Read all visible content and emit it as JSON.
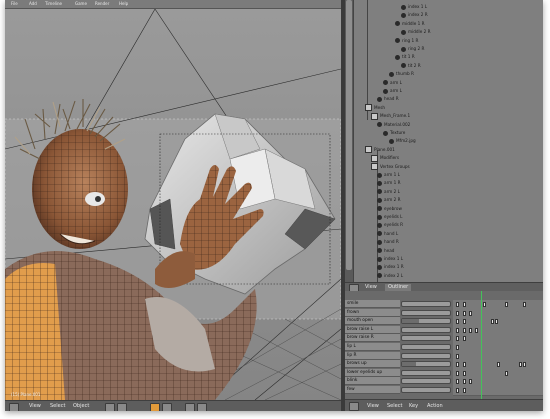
{
  "menubar": {
    "items": [
      "File",
      "Add",
      "Timeline",
      "Game",
      "Render",
      "Help"
    ]
  },
  "viewport": {
    "object_label": "(15) Plane.001",
    "footer": {
      "view": "View",
      "select": "Select",
      "object": "Object",
      "mode_icon": "mode-icon"
    }
  },
  "outliner": {
    "rows": [
      {
        "label": "index 1 L",
        "level": 7
      },
      {
        "label": "index 2 R",
        "level": 7
      },
      {
        "label": "middle 1 R",
        "level": 6
      },
      {
        "label": "middle 2 R",
        "level": 7
      },
      {
        "label": "ring 1 R",
        "level": 6
      },
      {
        "label": "ring 2 R",
        "level": 7
      },
      {
        "label": "tit 1 R",
        "level": 6
      },
      {
        "label": "tit 2 R",
        "level": 7
      },
      {
        "label": "thumb R",
        "level": 5
      },
      {
        "label": "arm L",
        "level": 4
      },
      {
        "label": "arm L",
        "level": 4
      },
      {
        "label": "head R",
        "level": 3
      },
      {
        "label": "Mesh",
        "level": 1
      },
      {
        "label": "Mesh_Frame.1",
        "level": 2
      },
      {
        "label": "Material.002",
        "level": 3
      },
      {
        "label": "Texture",
        "level": 4
      },
      {
        "label": "Mfm2.jpg",
        "level": 5
      },
      {
        "label": "Plane.001",
        "level": 1
      },
      {
        "label": "Modifiers",
        "level": 2
      },
      {
        "label": "Vertex Groups",
        "level": 2
      },
      {
        "label": "arm 1 L",
        "level": 3
      },
      {
        "label": "arm 1 R",
        "level": 3
      },
      {
        "label": "arm 2 L",
        "level": 3
      },
      {
        "label": "arm 2 R",
        "level": 3
      },
      {
        "label": "eyebrow",
        "level": 3
      },
      {
        "label": "eyelids L",
        "level": 3
      },
      {
        "label": "eyelids R",
        "level": 3
      },
      {
        "label": "hand L",
        "level": 3
      },
      {
        "label": "hand R",
        "level": 3
      },
      {
        "label": "head",
        "level": 3
      },
      {
        "label": "index 1 L",
        "level": 3
      },
      {
        "label": "index 1 R",
        "level": 3
      },
      {
        "label": "index 2 L",
        "level": 3
      }
    ],
    "footer": {
      "view": "View",
      "mode": "Outliner"
    }
  },
  "action": {
    "rows": [
      {
        "name": "smile",
        "value": 0.0,
        "keys": [
          3,
          10,
          30,
          52,
          70
        ]
      },
      {
        "name": "frown",
        "value": 0.0,
        "keys": [
          3,
          10,
          16
        ]
      },
      {
        "name": "mouth open",
        "value": 0.35,
        "keys": [
          3,
          10,
          38,
          42
        ]
      },
      {
        "name": "brow raise L",
        "value": 0.0,
        "keys": [
          3,
          10,
          16,
          22
        ]
      },
      {
        "name": "brow raise R",
        "value": 0.0,
        "keys": [
          3,
          10
        ]
      },
      {
        "name": "lip L",
        "value": 0.0,
        "keys": [
          3
        ]
      },
      {
        "name": "lip R",
        "value": 0.0,
        "keys": [
          3
        ]
      },
      {
        "name": "brows up",
        "value": 0.3,
        "keys": [
          3,
          10,
          44,
          66,
          70
        ]
      },
      {
        "name": "lower eyelids up",
        "value": 0.0,
        "keys": [
          3,
          10,
          52
        ]
      },
      {
        "name": "blink",
        "value": 0.0,
        "keys": [
          3,
          10,
          16
        ]
      },
      {
        "name": "few",
        "value": 0.0,
        "keys": [
          3,
          10
        ]
      }
    ],
    "footer": {
      "view": "View",
      "select": "Select",
      "key": "Key",
      "action": "Action"
    }
  },
  "colors": {
    "frame_marker": "#44c25a",
    "skin": "#a46a45",
    "shirt_highlight": "#f0a64a"
  }
}
